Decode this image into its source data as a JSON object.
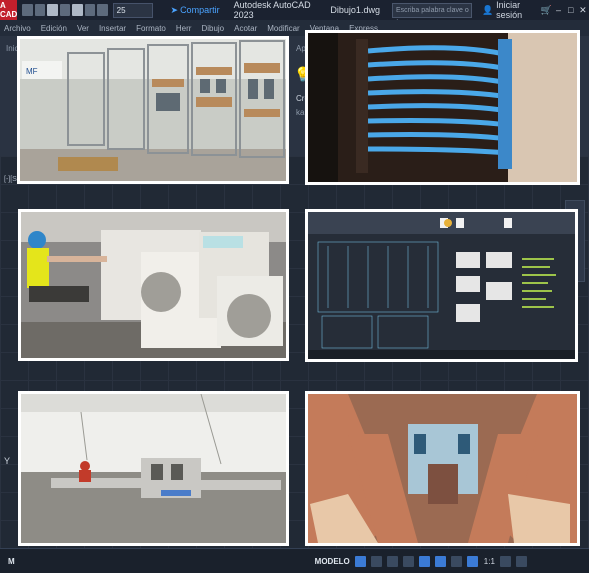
{
  "titlebar": {
    "app_logo": "A CAD",
    "zoom_value": "25",
    "share_label": "Compartir",
    "app_title": "Autodesk AutoCAD 2023",
    "document_title": "Dibujo1.dwg",
    "search_placeholder": "Escriba palabra clave o frase",
    "signin_label": "Iniciar sesión"
  },
  "menubar": {
    "items": [
      "Archivo",
      "Edición",
      "Ver",
      "Insertar",
      "Formato",
      "Herr",
      "Dibujo",
      "Acotar",
      "Modificar",
      "Ventana",
      "Express"
    ]
  },
  "ribbon": {
    "left_text": "Inic",
    "right_text": "Apli",
    "right_text2": "Cre",
    "right_text3": "ka"
  },
  "canvas": {
    "viewport_label": "[-][Sup",
    "ucs_label": "Y"
  },
  "statusbar": {
    "command_label": "M",
    "model_tab": "MODELO",
    "scale_label": "1:1"
  },
  "photos": [
    {
      "name": "photo-electrical-cabinets",
      "subject": "cabinets"
    },
    {
      "name": "photo-blue-cable-wiring",
      "subject": "cabling"
    },
    {
      "name": "photo-technician-hvac",
      "subject": "technician"
    },
    {
      "name": "photo-cad-schematic",
      "subject": "schematic"
    },
    {
      "name": "photo-industrial-workshop",
      "subject": "workshop"
    },
    {
      "name": "photo-busbar-closeup",
      "subject": "busbars"
    }
  ],
  "colors": {
    "accent_blue": "#3b7bd6",
    "logo_red": "#c21f2c",
    "canvas_dark": "#212935"
  }
}
